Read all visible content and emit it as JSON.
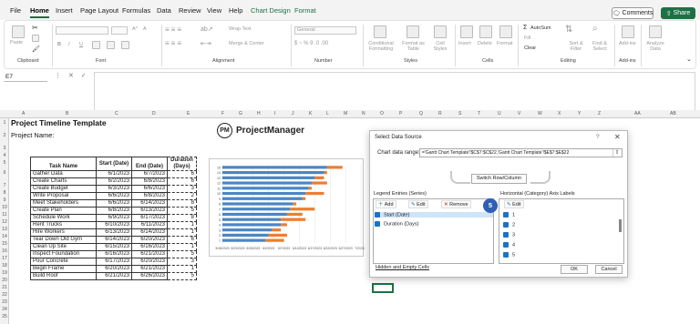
{
  "menu": {
    "tabs": [
      "File",
      "Home",
      "Insert",
      "Page Layout",
      "Formulas",
      "Data",
      "Review",
      "View",
      "Help",
      "Chart Design",
      "Format"
    ],
    "comments_label": "Comments",
    "share_label": "Share"
  },
  "ribbon": {
    "clipboard": "Clipboard",
    "paste": "Paste",
    "font": "Font",
    "bold": "B",
    "italic": "I",
    "underline": "U",
    "font_grow": "A^",
    "font_shrink": "A",
    "alignment": "Alignment",
    "wrap_text": "Wrap Text",
    "merge_center": "Merge & Center",
    "number": "Number",
    "number_format": "General",
    "number_symbols": "$ ~ % 9 .0 .00",
    "styles": "Styles",
    "conditional_formatting": "Conditional Formatting",
    "format_as_table": "Format as Table",
    "cell_styles": "Cell Styles",
    "cells": "Cells",
    "insert": "Insert",
    "delete": "Delete",
    "format": "Format",
    "editing": "Editing",
    "autosum": "AutoSum",
    "fill": "Fill",
    "clear": "Clear",
    "sort_filter": "Sort & Filter",
    "find_select": "Find & Select",
    "addins": "Add-ins",
    "addins_btn": "Add-ins",
    "analyze_data": "Analyze Data"
  },
  "formula_bar": {
    "name_box": "E7",
    "icons": "⋮ ✕ ✓ fx",
    "value": ""
  },
  "columns": [
    "A",
    "B",
    "C",
    "D",
    "E",
    "F",
    "G",
    "H",
    "I",
    "J",
    "K",
    "L",
    "M",
    "N",
    "O",
    "P",
    "Q",
    "R",
    "S",
    "T",
    "U",
    "V",
    "W",
    "X",
    "Y",
    "Z",
    "AA",
    "AB"
  ],
  "rows": [
    "1",
    "2",
    "3",
    "4",
    "5",
    "6",
    "7",
    "8",
    "9",
    "10",
    "11",
    "12",
    "13",
    "14",
    "15",
    "16",
    "17",
    "18",
    "19",
    "20",
    "21",
    "22",
    "23",
    "24",
    "25"
  ],
  "sheet": {
    "title": "Project Timeline Template",
    "project_name_label": "Project Name:",
    "logo_mark": "PM",
    "logo_text": "ProjectManager"
  },
  "table": {
    "headers": [
      "Task Name",
      "Start (Date)",
      "End (Date)",
      "Duration (Days)"
    ],
    "rows": [
      [
        "Gather Data",
        "6/1/2023",
        "6/7/2023",
        "6"
      ],
      [
        "Create Charts",
        "6/2/2023",
        "6/8/2023",
        "6"
      ],
      [
        "Create Budget",
        "6/3/2023",
        "6/6/2023",
        "3"
      ],
      [
        "Write Proposal",
        "6/6/2023",
        "6/8/2023",
        "2"
      ],
      [
        "Meet Stakeholders",
        "6/6/2023",
        "6/14/2023",
        "8"
      ],
      [
        "Create Plan",
        "6/8/2023",
        "6/13/2023",
        "5"
      ],
      [
        "Schedule Work",
        "6/9/2023",
        "6/17/2023",
        "8"
      ],
      [
        "Rent Trucks",
        "6/10/2023",
        "6/11/2023",
        "1"
      ],
      [
        "Hire Workers",
        "6/13/2023",
        "6/14/2023",
        "1"
      ],
      [
        "Tear Down Old Gym",
        "6/14/2023",
        "6/20/2023",
        "6"
      ],
      [
        "Clean Up Site",
        "6/15/2023",
        "6/16/2023",
        "1"
      ],
      [
        "Inspect Foundation",
        "6/16/2023",
        "6/21/2023",
        "5"
      ],
      [
        "Pour Concrete",
        "6/17/2023",
        "6/20/2023",
        "3"
      ],
      [
        "Begin Frame",
        "6/20/2023",
        "6/21/2023",
        "1"
      ],
      [
        "Build Roof",
        "6/21/2023",
        "6/26/2023",
        "5"
      ]
    ]
  },
  "chart_data": {
    "type": "bar",
    "orientation": "horizontal-stacked",
    "categories": [
      "1",
      "2",
      "3",
      "4",
      "5",
      "6",
      "7",
      "8",
      "9",
      "10",
      "11",
      "12",
      "13",
      "14",
      "15"
    ],
    "series": [
      {
        "name": "Start (Date)",
        "values": [
          "2023-06-01",
          "2023-06-02",
          "2023-06-03",
          "2023-06-06",
          "2023-06-06",
          "2023-06-08",
          "2023-06-09",
          "2023-06-10",
          "2023-06-13",
          "2023-06-14",
          "2023-06-15",
          "2023-06-16",
          "2023-06-17",
          "2023-06-20",
          "2023-06-21"
        ],
        "color": "#4a86c5"
      },
      {
        "name": "Duration (Days)",
        "values": [
          6,
          6,
          3,
          2,
          8,
          5,
          8,
          1,
          1,
          6,
          1,
          5,
          3,
          1,
          5
        ],
        "color": "#ed7d31"
      }
    ],
    "x_tick_labels": [
      "5/18/2023",
      "5/23/2023",
      "5/28/2023",
      "6/2/2023",
      "6/7/2023",
      "6/12/2023",
      "6/17/2023",
      "6/22/2023",
      "6/27/2023",
      "7/2/2023"
    ],
    "xlim": [
      "2023-05-18",
      "2023-07-02"
    ],
    "grid": true
  },
  "dialog": {
    "title": "Select Data Source",
    "help": "?",
    "close": "✕",
    "range_label": "Chart data range:",
    "range_value": "='Gantt Chart Template'!$C$7:$C$22,'Gantt Chart Template'!$E$7:$E$22",
    "switch_label": "Switch Row/Column",
    "legend_label": "Legend Entries (Series)",
    "axis_label": "Horizontal (Category) Axis Labels",
    "add": "Add",
    "edit": "Edit",
    "remove": "Remove",
    "axis_edit": "Edit",
    "series": [
      "Start (Date)",
      "Duration (Days)"
    ],
    "axis_items": [
      "1",
      "2",
      "3",
      "4",
      "5"
    ],
    "badge": "5",
    "hidden_empty": "Hidden and Empty Cells",
    "ok": "OK",
    "cancel": "Cancel"
  }
}
